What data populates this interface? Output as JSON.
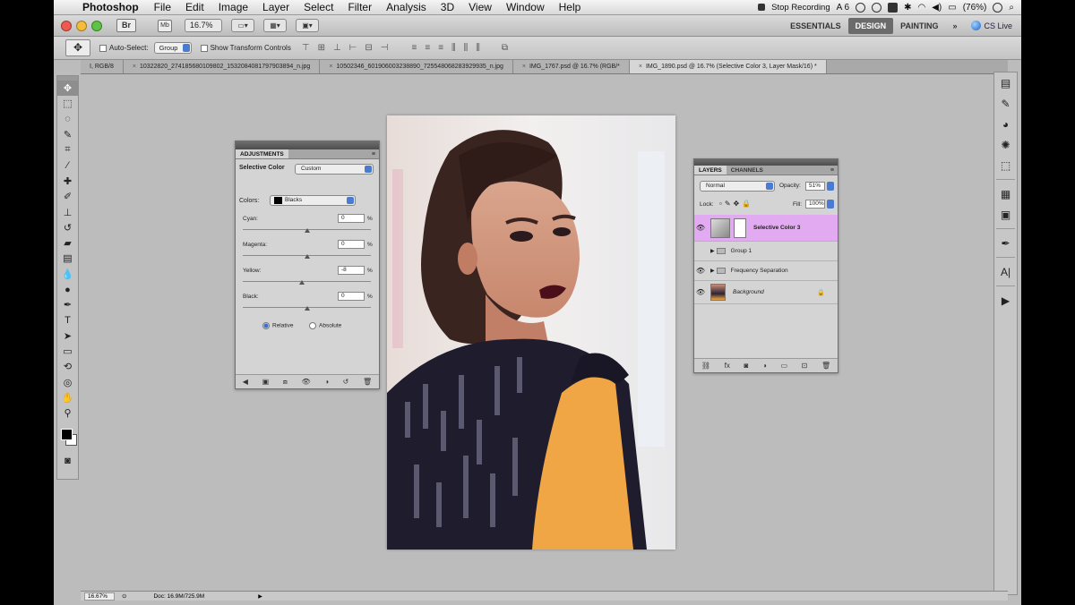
{
  "menubar": {
    "app_name": "Photoshop",
    "items": [
      "File",
      "Edit",
      "Image",
      "Layer",
      "Select",
      "Filter",
      "Analysis",
      "3D",
      "View",
      "Window",
      "Help"
    ],
    "status": {
      "recording": "Stop Recording",
      "adobe": "A 6",
      "battery": "(76%)"
    }
  },
  "appbar": {
    "br_label": "Br",
    "mb_label": "Mb",
    "zoom": "16.7%",
    "workspaces": [
      "ESSENTIALS",
      "DESIGN",
      "PAINTING"
    ],
    "active_workspace": "DESIGN",
    "more": "»",
    "cs_live": "CS Live"
  },
  "options": {
    "auto_select": "Auto-Select:",
    "auto_select_target": "Group",
    "show_transform": "Show Transform Controls"
  },
  "doc_tabs": [
    "I, RGB/8",
    "10322820_274185680109802_1532084081797903894_n.jpg",
    "10502346_601906003238890_725548068283929935_n.jpg",
    "IMG_1767.psd @ 16.7% (RGB/*",
    "IMG_1890.psd @ 16.7% (Selective Color 3, Layer Mask/16) *"
  ],
  "adjustments": {
    "tab_label": "ADJUSTMENTS",
    "title": "Selective Color",
    "preset": "Custom",
    "colors_label": "Colors:",
    "colors_value": "Blacks",
    "sliders": [
      {
        "label": "Cyan:",
        "value": "0",
        "level": 0
      },
      {
        "label": "Magenta:",
        "value": "0",
        "level": 0
      },
      {
        "label": "Yellow:",
        "value": "-8",
        "level": -8
      },
      {
        "label": "Black:",
        "value": "0",
        "level": 0
      }
    ],
    "pct": "%",
    "method_relative": "Relative",
    "method_absolute": "Absolute",
    "method_selected": "Relative"
  },
  "layers": {
    "tab_layers": "LAYERS",
    "tab_channels": "CHANNELS",
    "blend_mode": "Normal",
    "opacity_label": "Opacity:",
    "opacity_value": "51%",
    "lock_label": "Lock:",
    "fill_label": "Fill:",
    "fill_value": "100%",
    "rows": [
      {
        "name": "Selective Color 3",
        "kind": "adjustment",
        "selected": true
      },
      {
        "name": "Group 1",
        "kind": "group",
        "selected": false
      },
      {
        "name": "Frequency Separation",
        "kind": "group",
        "selected": false
      },
      {
        "name": "Background",
        "kind": "image",
        "selected": false
      }
    ]
  },
  "status": {
    "zoom": "16.67%",
    "doc": "Doc: 16.9M/725.9M"
  },
  "colors": {
    "selected_layer": "#e2aaf0",
    "accent": "#4a7bd1"
  }
}
